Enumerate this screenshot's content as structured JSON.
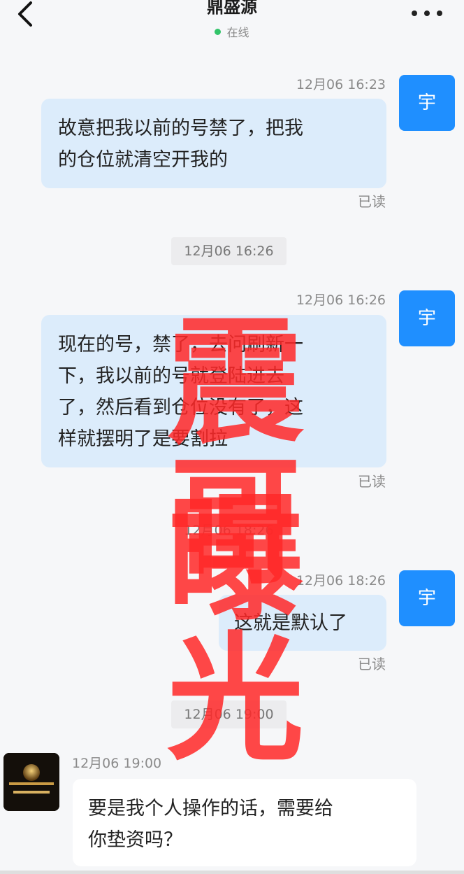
{
  "header": {
    "title": "鼎盛源",
    "status": "在线"
  },
  "messages": [
    {
      "time": "12月06 16:23",
      "avatar": "宇",
      "text_lines": [
        "故意把我以前的号禁了，把我",
        "的仓位就清空开我的"
      ],
      "read": "已读"
    },
    {
      "center_time": "12月06 16:26"
    },
    {
      "time": "12月06 16:26",
      "avatar": "宇",
      "text_lines": [
        "现在的号，禁了，去问刷新一",
        "下，我以前的号就登陆进去",
        "了，然后看到仓位没有了，这",
        "样就摆明了是要割拉"
      ],
      "read": "已读"
    },
    {
      "center_time": "12月06 18:26"
    },
    {
      "time": "12月06 18:26",
      "avatar": "宇",
      "text_lines": [
        "这就是默认了"
      ],
      "read": "已读"
    },
    {
      "center_time": "12月06 19:00"
    },
    {
      "time": "12月06 19:00",
      "text_lines": [
        "要是我个人操作的话，需要给",
        "你垫资吗？"
      ]
    }
  ],
  "watermark": {
    "line1": "震哥",
    "line2": "曝光",
    "color": "#ff2a2a"
  },
  "colors": {
    "accent": "#1f8fff",
    "bubble_me": "#dcecfb",
    "online": "#32c46a"
  }
}
